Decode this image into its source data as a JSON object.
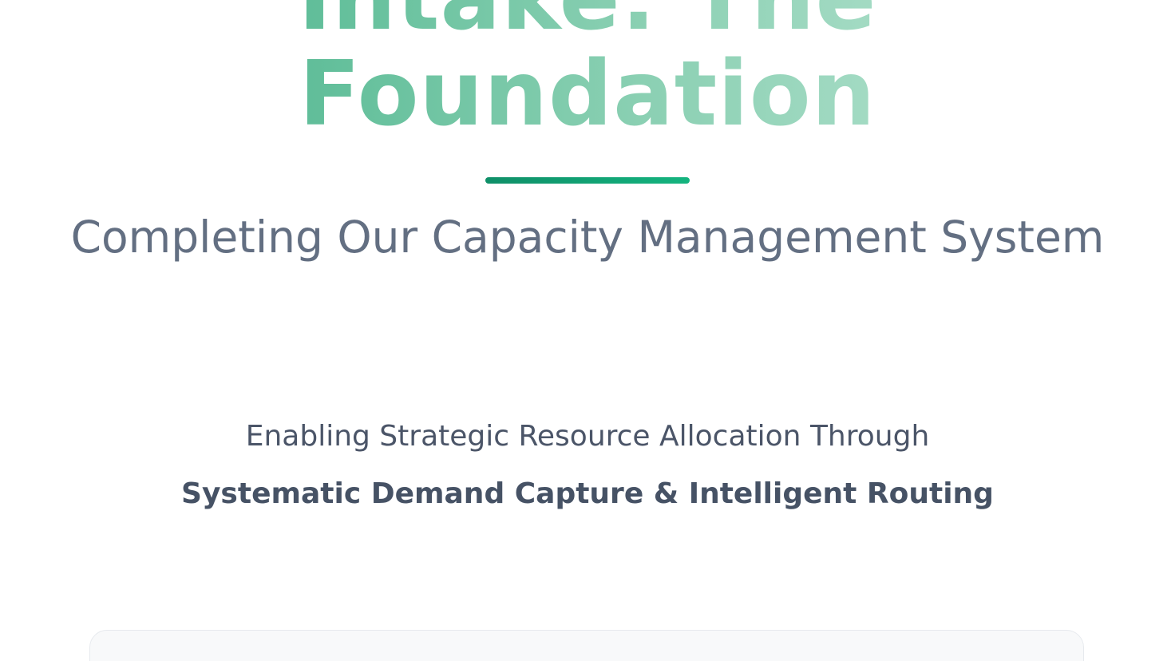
{
  "hero": {
    "title_line_1": "Intake: The",
    "title_line_2": "Foundation"
  },
  "subtitle": "Completing Our Capacity Management System",
  "tagline": {
    "line_1": "Enabling Strategic Resource Allocation Through",
    "line_2": "Systematic Demand Capture & Intelligent Routing"
  },
  "colors": {
    "accent_green": "#10B981",
    "accent_green_dark": "#0F8F68",
    "subtitle_gray": "#636F82",
    "body_slate": "#4B5568",
    "card_background": "#F8F9FA"
  }
}
